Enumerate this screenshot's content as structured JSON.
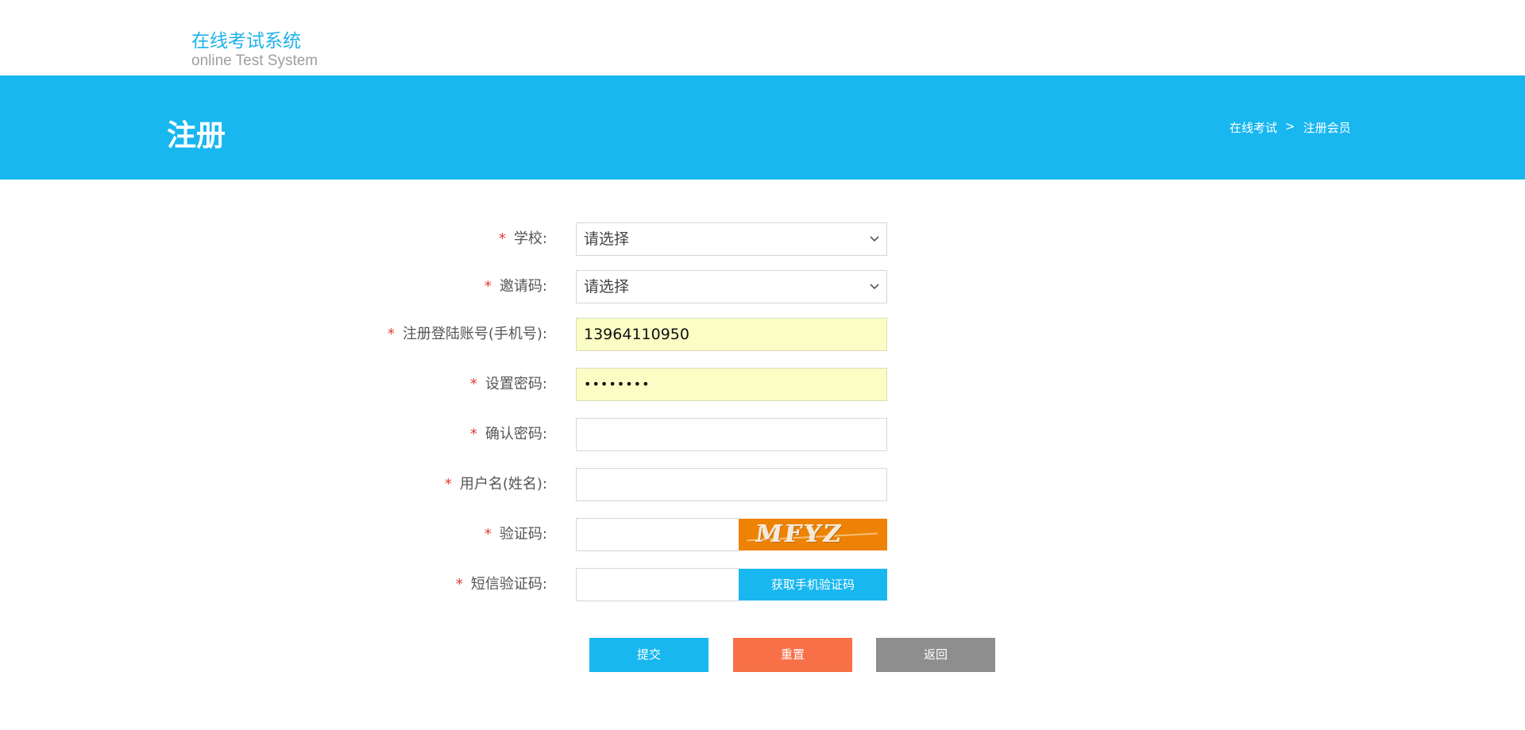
{
  "header": {
    "logo_cn": "在线考试系统",
    "logo_en": "online Test System"
  },
  "banner": {
    "title": "注册",
    "breadcrumb": [
      "在线考试",
      ">",
      "注册会员"
    ]
  },
  "form": {
    "required_mark": "*",
    "school": {
      "label": "学校:",
      "value": "请选择"
    },
    "invite_code": {
      "label": "邀请码:",
      "value": "请选择"
    },
    "account": {
      "label": "注册登陆账号(手机号):",
      "value": "13964110950"
    },
    "password": {
      "label": "设置密码:",
      "value": "••••••••"
    },
    "confirm_password": {
      "label": "确认密码:",
      "value": ""
    },
    "username": {
      "label": "用户名(姓名):",
      "value": ""
    },
    "captcha": {
      "label": "验证码:",
      "value": "",
      "image_text": "MFYZ"
    },
    "sms_code": {
      "label": "短信验证码:",
      "value": "",
      "button_label": "获取手机验证码"
    }
  },
  "actions": {
    "submit": "提交",
    "reset": "重置",
    "back": "返回"
  },
  "colors": {
    "brand": "#18b7f0",
    "reset": "#f77048",
    "back": "#8e8e8e",
    "required": "#e53935",
    "autofill": "#fafdc4",
    "captcha_bg": "#ee8205"
  }
}
